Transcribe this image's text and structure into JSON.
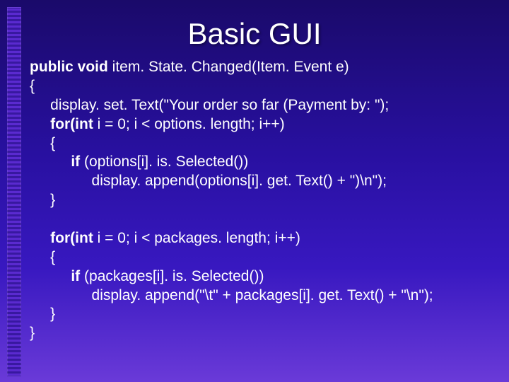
{
  "title": "Basic GUI",
  "code": {
    "l1a": "public void",
    "l1b": " item. State. Changed(Item. Event e)",
    "l2": "{",
    "l3": "     display. set. Text(\"Your order so far (Payment by: \");",
    "l4a": "     for(int",
    "l4b": " i = 0; i < options. length; i++)",
    "l5": "     {",
    "l6a": "          if",
    "l6b": " (options[i]. is. Selected())",
    "l7": "               display. append(options[i]. get. Text() + \")\\n\");",
    "l8": "     }",
    "l9": "",
    "l10a": "     for(int",
    "l10b": " i = 0; i < packages. length; i++)",
    "l11": "     {",
    "l12a": "          if",
    "l12b": " (packages[i]. is. Selected())",
    "l13": "               display. append(\"\\t\" + packages[i]. get. Text() + \"\\n\");",
    "l14": "     }",
    "l15": "}"
  }
}
